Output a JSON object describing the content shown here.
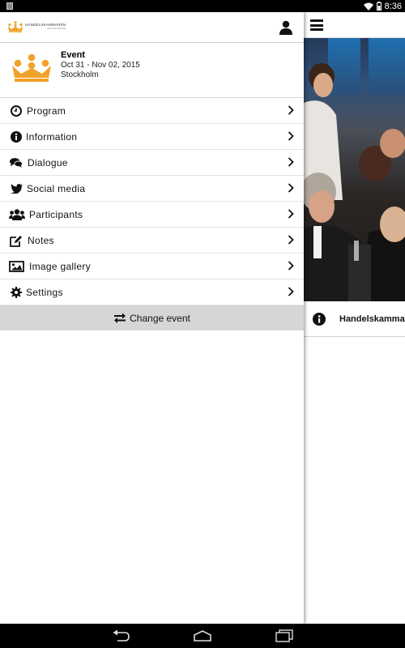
{
  "status_bar": {
    "time": "8:36",
    "icons": [
      "notification-icon",
      "wifi-icon",
      "battery-icon"
    ]
  },
  "drawer": {
    "brand": {
      "name": "HANDELSKAMMAREN",
      "sub": "STOCKHOLMS"
    },
    "event": {
      "title": "Event",
      "dates": "Oct 31 - Nov 02, 2015",
      "location": "Stockholm"
    },
    "menu": [
      {
        "label": "Program",
        "icon": "clock-icon"
      },
      {
        "label": "Information",
        "icon": "info-icon"
      },
      {
        "label": "Dialogue",
        "icon": "chat-icon"
      },
      {
        "label": "Social media",
        "icon": "twitter-icon"
      },
      {
        "label": "Participants",
        "icon": "people-icon"
      },
      {
        "label": "Notes",
        "icon": "edit-icon"
      },
      {
        "label": "Image gallery",
        "icon": "image-icon"
      },
      {
        "label": "Settings",
        "icon": "gear-icon"
      }
    ],
    "change_event_label": "Change event"
  },
  "main": {
    "info_row_text": "Handelskamma"
  },
  "colors": {
    "accent": "#f0a22a",
    "status_bar": "#000000",
    "change_event_bg": "#d6d6d6"
  }
}
